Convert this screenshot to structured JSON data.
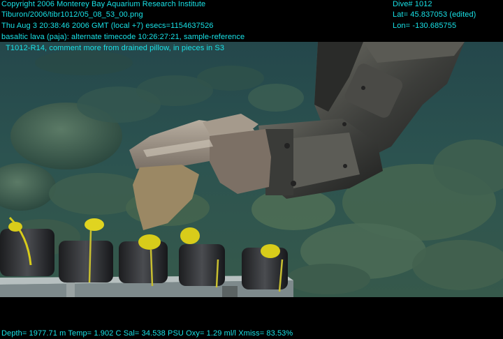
{
  "overlay": {
    "header_lines": [
      "Copyright 2006 Monterey Bay Aquarium Research Institute",
      "Tiburon/2006/tibr1012/05_08_53_00.png",
      "Thu Aug  3 20:38:46 2006 GMT (local +7)  esecs=1154637526",
      "basaltic lava (paja): alternate timecode 10:26:27:21, sample-reference",
      "  T1012-R14, comment more from drained pillow, in pieces in S3"
    ],
    "dive": "Dive# 1012",
    "lat": "Lat= 45.837053 (edited)",
    "lon": "Lon= -130.685755",
    "footer": "Depth= 1977.71 m  Temp= 1.902 C  Sal= 34.538 PSU  Oxy= 1.29 ml/l  Xmiss= 83.53%"
  },
  "colors": {
    "overlay_text": "#19e3e8",
    "water": "#1e3e44",
    "seafloor": "#3a5a4c"
  },
  "scene": {
    "subjects": [
      "seafloor-pillow-lava",
      "rov-manipulator-arm",
      "basalt-sample-in-claw",
      "sample-canister-tray"
    ]
  }
}
